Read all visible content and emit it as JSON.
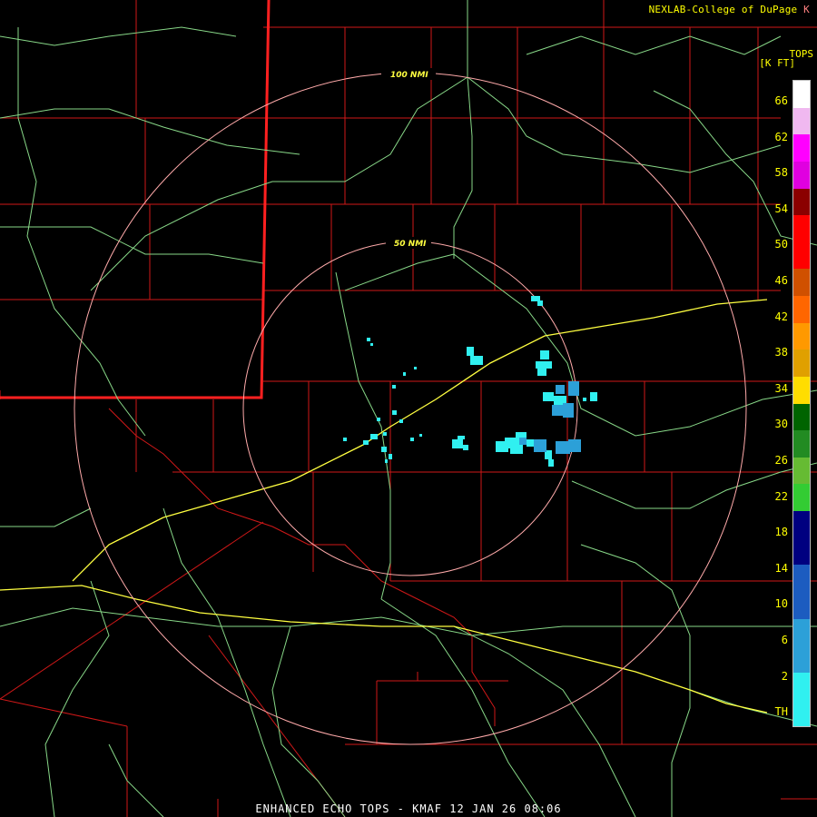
{
  "credit": {
    "text": "NEXLAB-College of DuPage",
    "mark": "K"
  },
  "legend": {
    "title": "TOPS",
    "units": "[K FT]",
    "ticks": [
      "66",
      "62",
      "58",
      "54",
      "50",
      "46",
      "42",
      "38",
      "34",
      "30",
      "26",
      "22",
      "18",
      "14",
      "10",
      "6",
      "2",
      "TH"
    ],
    "colors_top_to_bottom": [
      "#ffffff",
      "#f0b8f0",
      "#ff00ff",
      "#e000e0",
      "#8b0000",
      "#ff0000",
      "#ff0000",
      "#d05000",
      "#ff6600",
      "#ff9900",
      "#e0a000",
      "#ffdd00",
      "#006400",
      "#228b22",
      "#66bb33",
      "#33cc33",
      "#000080",
      "#000080",
      "#1c5cc0",
      "#1c5cc0",
      "#2ca0d8",
      "#2ca0d8",
      "#30f0f0",
      "#30f0f0"
    ]
  },
  "range_rings": [
    {
      "label": "100 NMI"
    },
    {
      "label": "50 NMI"
    }
  ],
  "footer": "ENHANCED ECHO TOPS - KMAF 12 JAN 26 08:06",
  "colors": {
    "background": "#000000",
    "county_lines": "#d01818",
    "state_line": "#ff2020",
    "roads": "#88d888",
    "highway": "#ffff40",
    "rings": "#ffaaaa",
    "echo": "#30f0f0"
  }
}
